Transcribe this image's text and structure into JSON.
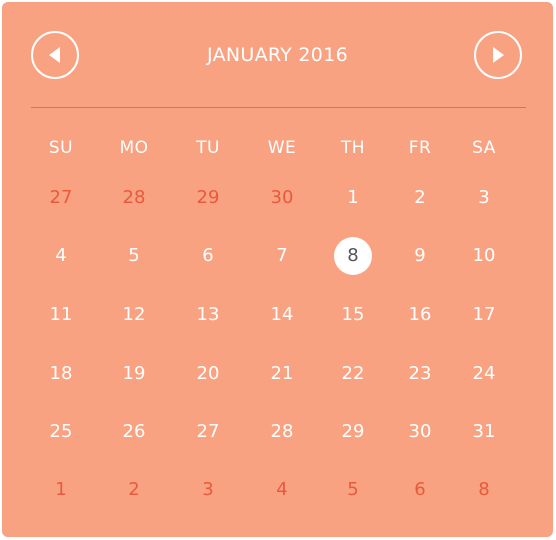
{
  "header": {
    "title": "JANUARY 2016",
    "prev_icon": "triangle-left-icon",
    "next_icon": "triangle-right-icon"
  },
  "weekdays": [
    "SU",
    "MO",
    "TU",
    "WE",
    "TH",
    "FR",
    "SA"
  ],
  "weeks": [
    [
      {
        "label": "27",
        "other": true
      },
      {
        "label": "28",
        "other": true
      },
      {
        "label": "29",
        "other": true
      },
      {
        "label": "30",
        "other": true
      },
      {
        "label": "1",
        "other": false
      },
      {
        "label": "2",
        "other": false
      },
      {
        "label": "3",
        "other": false
      }
    ],
    [
      {
        "label": "4",
        "other": false
      },
      {
        "label": "5",
        "other": false
      },
      {
        "label": "6",
        "other": false
      },
      {
        "label": "7",
        "other": false
      },
      {
        "label": "8",
        "other": false,
        "selected": true
      },
      {
        "label": "9",
        "other": false
      },
      {
        "label": "10",
        "other": false
      }
    ],
    [
      {
        "label": "11",
        "other": false
      },
      {
        "label": "12",
        "other": false
      },
      {
        "label": "13",
        "other": false
      },
      {
        "label": "14",
        "other": false
      },
      {
        "label": "15",
        "other": false
      },
      {
        "label": "16",
        "other": false
      },
      {
        "label": "17",
        "other": false
      }
    ],
    [
      {
        "label": "18",
        "other": false
      },
      {
        "label": "19",
        "other": false
      },
      {
        "label": "20",
        "other": false
      },
      {
        "label": "21",
        "other": false
      },
      {
        "label": "22",
        "other": false
      },
      {
        "label": "23",
        "other": false
      },
      {
        "label": "24",
        "other": false
      }
    ],
    [
      {
        "label": "25",
        "other": false
      },
      {
        "label": "26",
        "other": false
      },
      {
        "label": "27",
        "other": false
      },
      {
        "label": "28",
        "other": false
      },
      {
        "label": "29",
        "other": false
      },
      {
        "label": "30",
        "other": false
      },
      {
        "label": "31",
        "other": false
      }
    ],
    [
      {
        "label": "1",
        "other": true
      },
      {
        "label": "2",
        "other": true
      },
      {
        "label": "3",
        "other": true
      },
      {
        "label": "4",
        "other": true
      },
      {
        "label": "5",
        "other": true
      },
      {
        "label": "6",
        "other": true
      },
      {
        "label": "8",
        "other": true
      }
    ]
  ],
  "colors": {
    "background": "#f8a282",
    "divider": "#ee6a4c",
    "other_month_text": "#e85a3c",
    "current_month_text": "#ffffff",
    "selected_background": "#ffffff",
    "selected_text": "#555555"
  }
}
